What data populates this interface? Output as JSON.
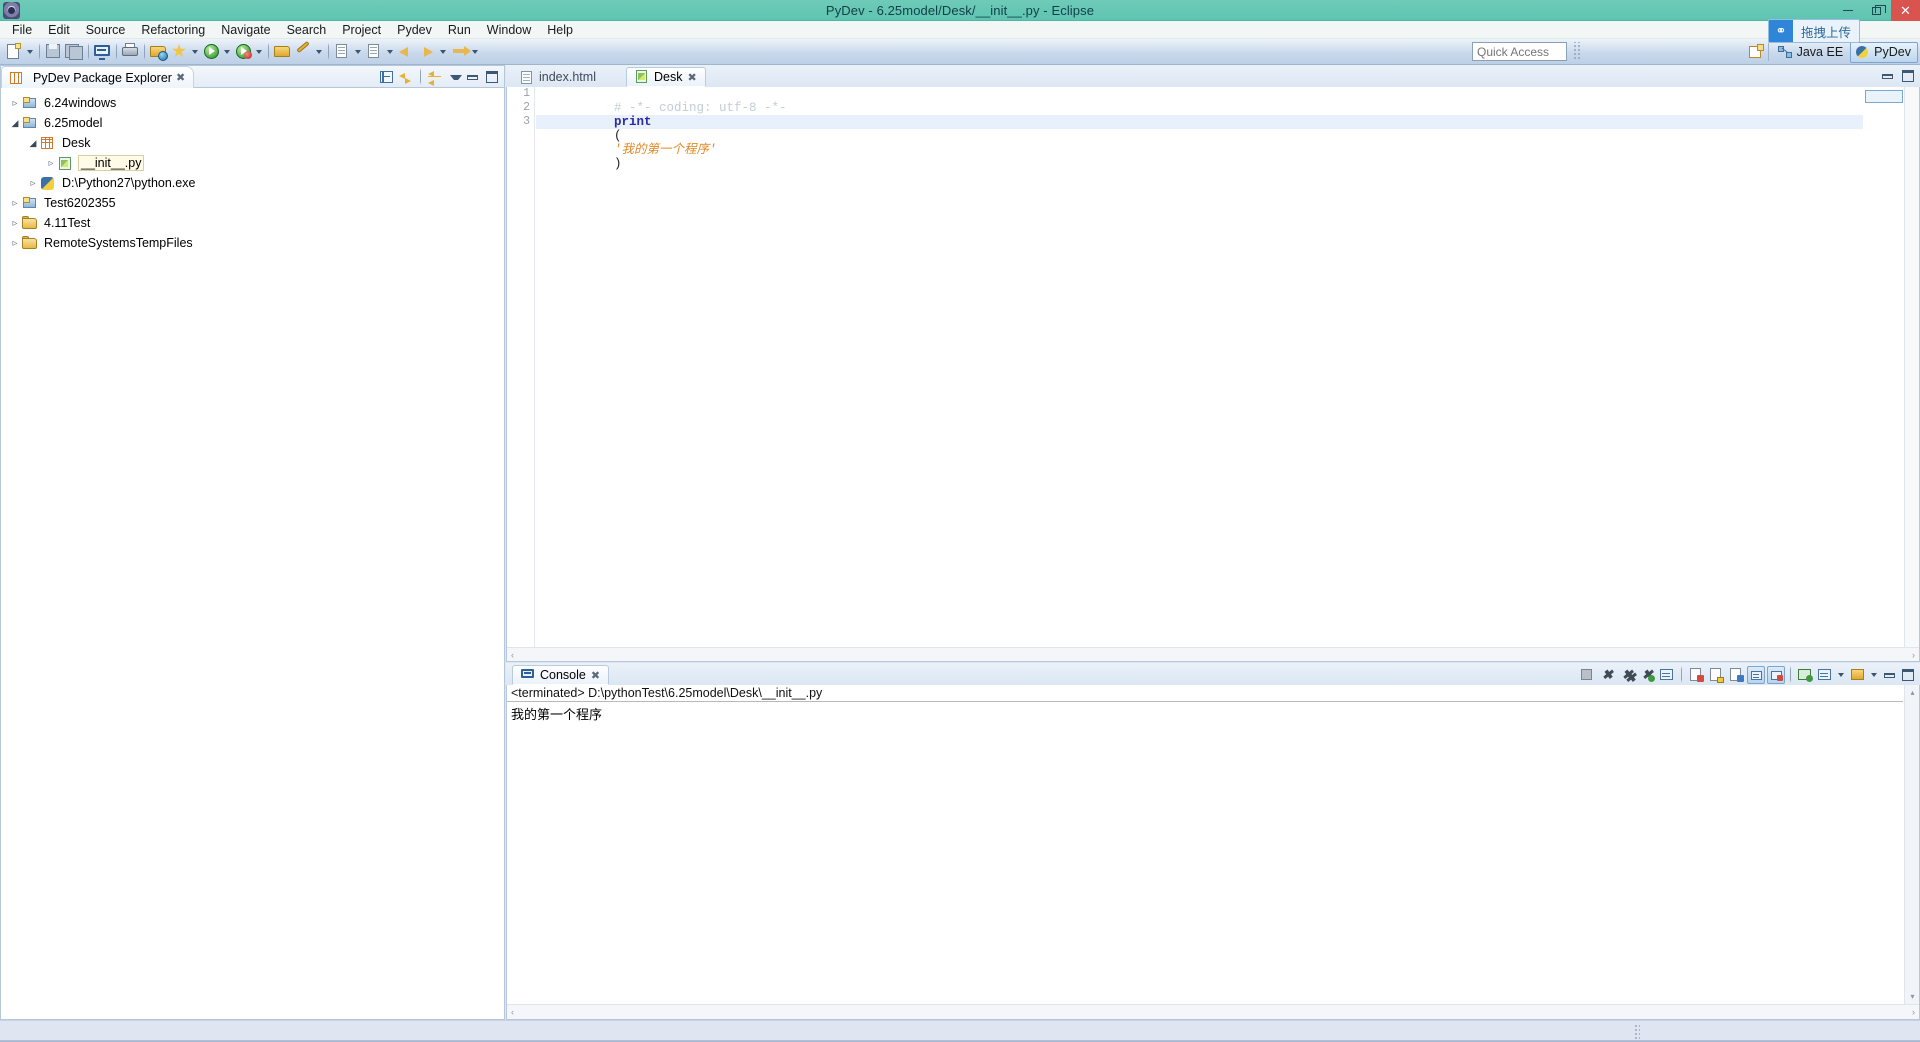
{
  "window": {
    "title": "PyDev - 6.25model/Desk/__init__.py - Eclipse",
    "app_icon": "eclipse-icon",
    "controls": {
      "minimize": "–",
      "restore": "❐",
      "close": "✕"
    },
    "accent_titlebar": "#5ec4b0",
    "close_color": "#d9534f"
  },
  "menu": {
    "items": [
      {
        "label": "File"
      },
      {
        "label": "Edit"
      },
      {
        "label": "Source"
      },
      {
        "label": "Refactoring"
      },
      {
        "label": "Navigate"
      },
      {
        "label": "Search"
      },
      {
        "label": "Project"
      },
      {
        "label": "Pydev"
      },
      {
        "label": "Run"
      },
      {
        "label": "Window"
      },
      {
        "label": "Help"
      }
    ]
  },
  "toolbar": {
    "items": [
      {
        "icon": "new-wizard-icon",
        "dropdown": true
      },
      {
        "sep": true
      },
      {
        "icon": "save-icon",
        "dropdown": false
      },
      {
        "icon": "save-all-icon",
        "dropdown": false
      },
      {
        "sep": true
      },
      {
        "icon": "console-icon",
        "dropdown": false
      },
      {
        "sep": true
      },
      {
        "icon": "print-icon",
        "dropdown": false
      },
      {
        "sep": true
      },
      {
        "icon": "open-browser-icon",
        "dropdown": false
      },
      {
        "icon": "debug-icon",
        "dropdown": true
      },
      {
        "icon": "run-icon",
        "dropdown": true
      },
      {
        "icon": "run-external-icon",
        "dropdown": true
      },
      {
        "sep": true
      },
      {
        "icon": "open-folder-icon",
        "dropdown": false
      },
      {
        "icon": "search-icon",
        "dropdown": true
      },
      {
        "sep": true
      },
      {
        "icon": "next-annotation-icon",
        "dropdown": true
      },
      {
        "icon": "open-type-icon",
        "dropdown": true
      },
      {
        "icon": "back-icon",
        "dropdown": false
      },
      {
        "icon": "forward-icon",
        "dropdown": true
      },
      {
        "icon": "last-edit-icon",
        "dropdown": true
      }
    ],
    "quick_access_placeholder": "Quick Access",
    "quick_access_value": "",
    "upload_badge": {
      "icon": "drag-upload-icon",
      "label": "拖拽上传"
    },
    "perspectives": [
      {
        "icon": "open-perspective-icon",
        "label": ""
      },
      {
        "icon": "java-ee-icon",
        "label": "Java EE",
        "active": false
      },
      {
        "icon": "pydev-icon",
        "label": "PyDev",
        "active": true
      }
    ]
  },
  "explorer": {
    "tab_label": "PyDev Package Explorer",
    "tab_icon": "package-explorer-icon",
    "tab_close": "✖",
    "toolbar": [
      {
        "icon": "collapse-all-icon"
      },
      {
        "icon": "link-with-editor-icon"
      },
      {
        "sep": true
      },
      {
        "icon": "view-menu-focus-icon"
      },
      {
        "icon": "view-menu-icon"
      },
      {
        "icon": "minimize-view-icon"
      },
      {
        "icon": "maximize-view-icon"
      }
    ],
    "tree": [
      {
        "label": "6.24windows",
        "icon": "pydev-project-icon",
        "indent": 0,
        "state": "closed",
        "selected": false
      },
      {
        "label": "6.25model",
        "icon": "pydev-project-icon",
        "indent": 0,
        "state": "open",
        "selected": false
      },
      {
        "label": "Desk",
        "icon": "source-package-icon",
        "indent": 1,
        "state": "open",
        "selected": false
      },
      {
        "label": "__init__.py",
        "icon": "python-file-icon",
        "indent": 2,
        "state": "closed",
        "selected": true
      },
      {
        "label": "D:\\Python27\\python.exe",
        "icon": "python-interpreter-icon",
        "indent": 1,
        "state": "closed",
        "selected": false
      },
      {
        "label": "Test6202355",
        "icon": "pydev-project-icon",
        "indent": 0,
        "state": "closed",
        "selected": false
      },
      {
        "label": "4.11Test",
        "icon": "folder-icon",
        "indent": 0,
        "state": "closed",
        "selected": false
      },
      {
        "label": "RemoteSystemsTempFiles",
        "icon": "folder-icon",
        "indent": 0,
        "state": "closed",
        "selected": false
      }
    ]
  },
  "editor": {
    "tabs": [
      {
        "label": "index.html",
        "icon": "html-file-icon",
        "active": false,
        "close": ""
      },
      {
        "label": "Desk",
        "icon": "python-file-icon",
        "active": true,
        "close": "✖"
      }
    ],
    "toolbar": [
      {
        "icon": "minimize-view-icon"
      },
      {
        "icon": "maximize-view-icon"
      }
    ],
    "line_numbers": [
      "1",
      "2",
      "3"
    ],
    "lines": [
      {
        "n": 1,
        "active": false,
        "tokens": [
          {
            "type": "comment",
            "text": "# -*- coding: utf-8 -*-",
            "underline_from": "utf-8"
          }
        ]
      },
      {
        "n": 2,
        "active": false,
        "tokens": [
          {
            "type": "keyword",
            "text": "print"
          },
          {
            "type": "punct",
            "text": "("
          },
          {
            "type": "string",
            "text": "'我的第一个程序'"
          },
          {
            "type": "punct",
            "text": ")"
          }
        ]
      },
      {
        "n": 3,
        "active": true,
        "tokens": []
      }
    ],
    "code_line1": "# -*- coding: utf-8 -*-",
    "code_line2_kw": "print",
    "code_line2_open": "(",
    "code_line2_str": "'我的第一个程序'",
    "code_line2_close": ")",
    "scroll_left_glyph": "‹",
    "scroll_right_glyph": "›"
  },
  "console": {
    "tab_label": "Console",
    "tab_icon": "console-icon",
    "tab_close": "✖",
    "header": "<terminated> D:\\pythonTest\\6.25model\\Desk\\__init__.py",
    "output": "我的第一个程序",
    "toolbar": [
      {
        "icon": "terminate-icon",
        "pressed": false
      },
      {
        "icon": "remove-launch-icon",
        "pressed": false
      },
      {
        "icon": "remove-all-terminated-icon",
        "pressed": false
      },
      {
        "icon": "terminate-relaunch-icon",
        "pressed": false
      },
      {
        "icon": "new-console-view-icon",
        "pressed": false
      },
      {
        "sep": true
      },
      {
        "icon": "clear-console-icon",
        "pressed": false
      },
      {
        "icon": "scroll-lock-icon",
        "pressed": false
      },
      {
        "icon": "word-wrap-icon",
        "pressed": false
      },
      {
        "icon": "show-console-on-output-icon",
        "pressed": true
      },
      {
        "icon": "show-console-on-error-icon",
        "pressed": true
      },
      {
        "sep": true
      },
      {
        "icon": "pin-console-icon",
        "pressed": false
      },
      {
        "icon": "display-selected-console-icon",
        "pressed": false,
        "dropdown": true
      },
      {
        "icon": "open-console-icon",
        "pressed": false,
        "dropdown": true
      },
      {
        "icon": "minimize-view-icon",
        "pressed": false
      },
      {
        "icon": "maximize-view-icon",
        "pressed": false
      }
    ],
    "scroll_up_glyph": "▴",
    "scroll_down_glyph": "▾",
    "scroll_left_glyph": "‹",
    "scroll_right_glyph": "›"
  },
  "statusbar": {
    "text": "",
    "handle_icon": "resize-handle-icon"
  }
}
